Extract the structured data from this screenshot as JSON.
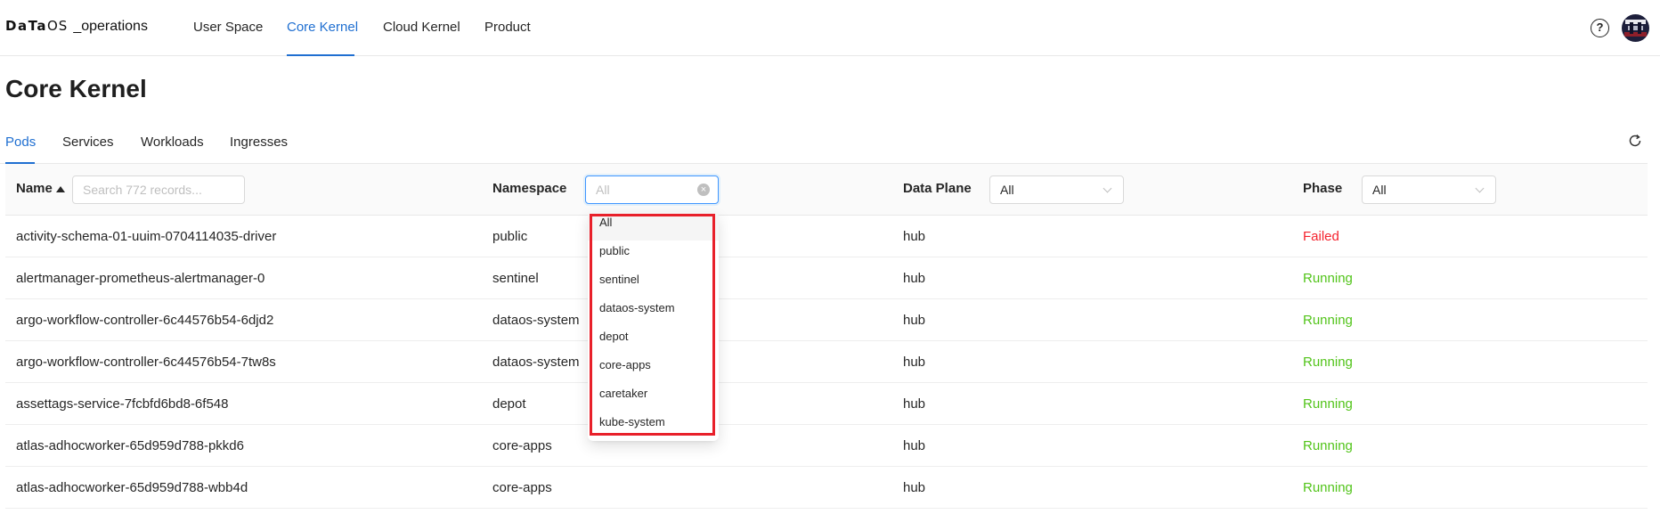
{
  "app": {
    "brand_bold": "DaTa",
    "brand_thin": "OS",
    "brand_suffix": "_operations"
  },
  "nav": {
    "items": [
      {
        "label": "User Space"
      },
      {
        "label": "Core Kernel"
      },
      {
        "label": "Cloud Kernel"
      },
      {
        "label": "Product"
      }
    ],
    "active": "Core Kernel",
    "help_glyph": "?",
    "help_icon": "question-circle-icon",
    "avatar_icon": "user-avatar"
  },
  "page": {
    "title": "Core Kernel"
  },
  "tabs": {
    "items": [
      {
        "label": "Pods"
      },
      {
        "label": "Services"
      },
      {
        "label": "Workloads"
      },
      {
        "label": "Ingresses"
      }
    ],
    "active": "Pods",
    "refresh_icon": "refresh-icon"
  },
  "table": {
    "columns": {
      "name": "Name",
      "namespace": "Namespace",
      "data_plane": "Data Plane",
      "phase": "Phase"
    },
    "search_placeholder": "Search 772 records...",
    "namespace_filter": {
      "placeholder": "All",
      "clear_glyph": "×"
    },
    "data_plane_filter": {
      "value": "All"
    },
    "phase_filter": {
      "value": "All"
    },
    "rows": [
      {
        "name": "activity-schema-01-uuim-0704114035-driver",
        "namespace": "public",
        "data_plane": "hub",
        "phase": "Failed"
      },
      {
        "name": "alertmanager-prometheus-alertmanager-0",
        "namespace": "sentinel",
        "data_plane": "hub",
        "phase": "Running"
      },
      {
        "name": "argo-workflow-controller-6c44576b54-6djd2",
        "namespace": "dataos-system",
        "data_plane": "hub",
        "phase": "Running"
      },
      {
        "name": "argo-workflow-controller-6c44576b54-7tw8s",
        "namespace": "dataos-system",
        "data_plane": "hub",
        "phase": "Running"
      },
      {
        "name": "assettags-service-7fcbfd6bd8-6f548",
        "namespace": "depot",
        "data_plane": "hub",
        "phase": "Running"
      },
      {
        "name": "atlas-adhocworker-65d959d788-pkkd6",
        "namespace": "core-apps",
        "data_plane": "hub",
        "phase": "Running"
      },
      {
        "name": "atlas-adhocworker-65d959d788-wbb4d",
        "namespace": "core-apps",
        "data_plane": "hub",
        "phase": "Running"
      }
    ]
  },
  "namespace_dropdown": {
    "options": [
      "All",
      "public",
      "sentinel",
      "dataos-system",
      "depot",
      "core-apps",
      "caretaker",
      "kube-system"
    ],
    "selected": "All"
  },
  "colors": {
    "accent": "#1f6fd1",
    "failed": "#f5222d",
    "running": "#52c41a",
    "highlight": "#e8202a"
  }
}
